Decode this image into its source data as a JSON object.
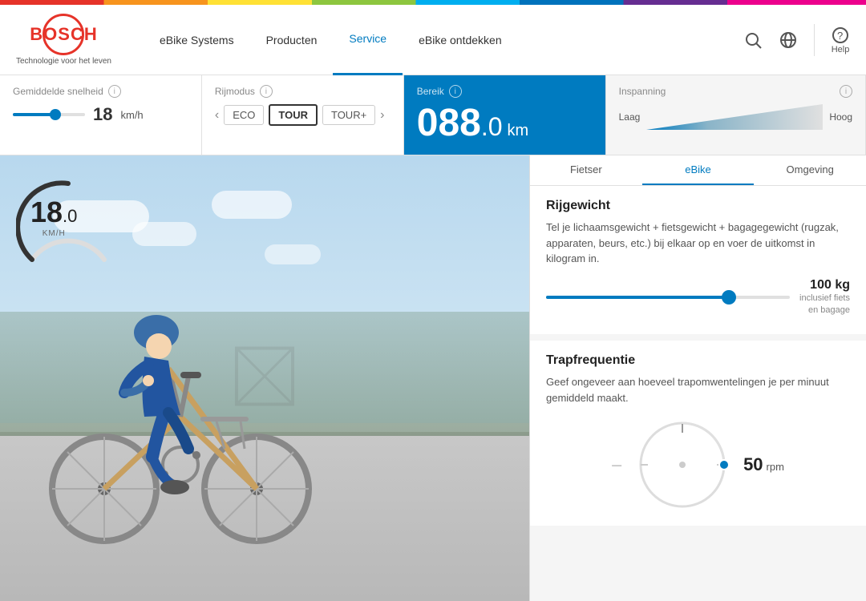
{
  "colorbar": "visible",
  "header": {
    "logo_text": "BOSCH",
    "logo_tagline": "Technologie voor het leven",
    "nav_items": [
      {
        "label": "eBike Systems",
        "active": false
      },
      {
        "label": "Producten",
        "active": false
      },
      {
        "label": "Service",
        "active": true
      },
      {
        "label": "eBike ontdekken",
        "active": false
      }
    ],
    "icon_search": "🔍",
    "icon_globe": "🌐",
    "icon_help": "?",
    "help_label": "Help"
  },
  "controls": {
    "speed_label": "Gemiddelde snelheid",
    "speed_value": "18",
    "speed_unit": "km/h",
    "mode_label": "Rijmodus",
    "modes": [
      "ECO",
      "TOUR",
      "TOUR+"
    ],
    "active_mode": "TOUR",
    "bereik_label": "Bereik",
    "bereik_value": "088",
    "bereik_decimal": ".0",
    "bereik_unit": "km"
  },
  "right_panel": {
    "inspanning_label": "Inspanning",
    "low_label": "Laag",
    "high_label": "Hoog",
    "tabs": [
      {
        "label": "Fietser",
        "active": false
      },
      {
        "label": "eBike",
        "active": true
      },
      {
        "label": "Omgeving",
        "active": false
      }
    ],
    "rijgewicht": {
      "title": "Rijgewicht",
      "description": "Tel je lichaamsgewicht + fietsgewicht + bagagegewicht (rugzak, apparaten, beurs, etc.) bij elkaar op en voer de uitkomst in kilogram in.",
      "value": "100",
      "unit": "kg",
      "subtext": "inclusief fiets\nen bagage",
      "slider_percent": 75
    },
    "trapfrequentie": {
      "title": "Trapfrequentie",
      "description": "Geef ongeveer aan hoeveel trapomwentelingen je per minuut gemiddeld maakt.",
      "value": "50",
      "unit": "rpm",
      "knob_angle": 90
    }
  },
  "viz": {
    "speed_display": "18.0",
    "speed_unit_small": "KM/H"
  }
}
